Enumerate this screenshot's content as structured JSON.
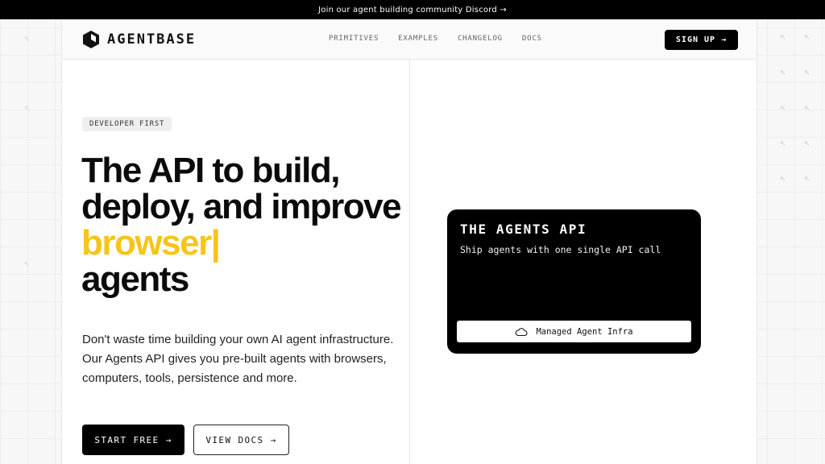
{
  "announcement": {
    "text": "Join our agent building community Discord →"
  },
  "brand": {
    "name": "AGENTBASE",
    "logo_icon": "cube-logo-icon"
  },
  "nav": {
    "links": [
      {
        "label": "PRIMITIVES"
      },
      {
        "label": "EXAMPLES"
      },
      {
        "label": "CHANGELOG"
      },
      {
        "label": "DOCS"
      }
    ],
    "signup_label": "SIGN UP →"
  },
  "hero": {
    "badge": "DEVELOPER FIRST",
    "headline_line1": "The API to build,",
    "headline_line2": "deploy, and improve",
    "headline_highlight": "browser|",
    "headline_line4": "agents",
    "description": "Don't waste time building your own AI agent infrastructure. Our Agents API gives you pre-built agents with browsers, computers, tools, persistence and more.",
    "primary_cta": "START FREE →",
    "secondary_cta": "VIEW DOCS →"
  },
  "card": {
    "title": "THE AGENTS API",
    "subtitle": "Ship agents with one single API call",
    "footer_icon": "cloud-icon",
    "footer_label": "Managed Agent Infra"
  },
  "colors": {
    "accent_yellow": "#f5c518",
    "black": "#000000",
    "background": "#f7f7f7"
  },
  "decor": {
    "grid_glyph": "↖"
  }
}
